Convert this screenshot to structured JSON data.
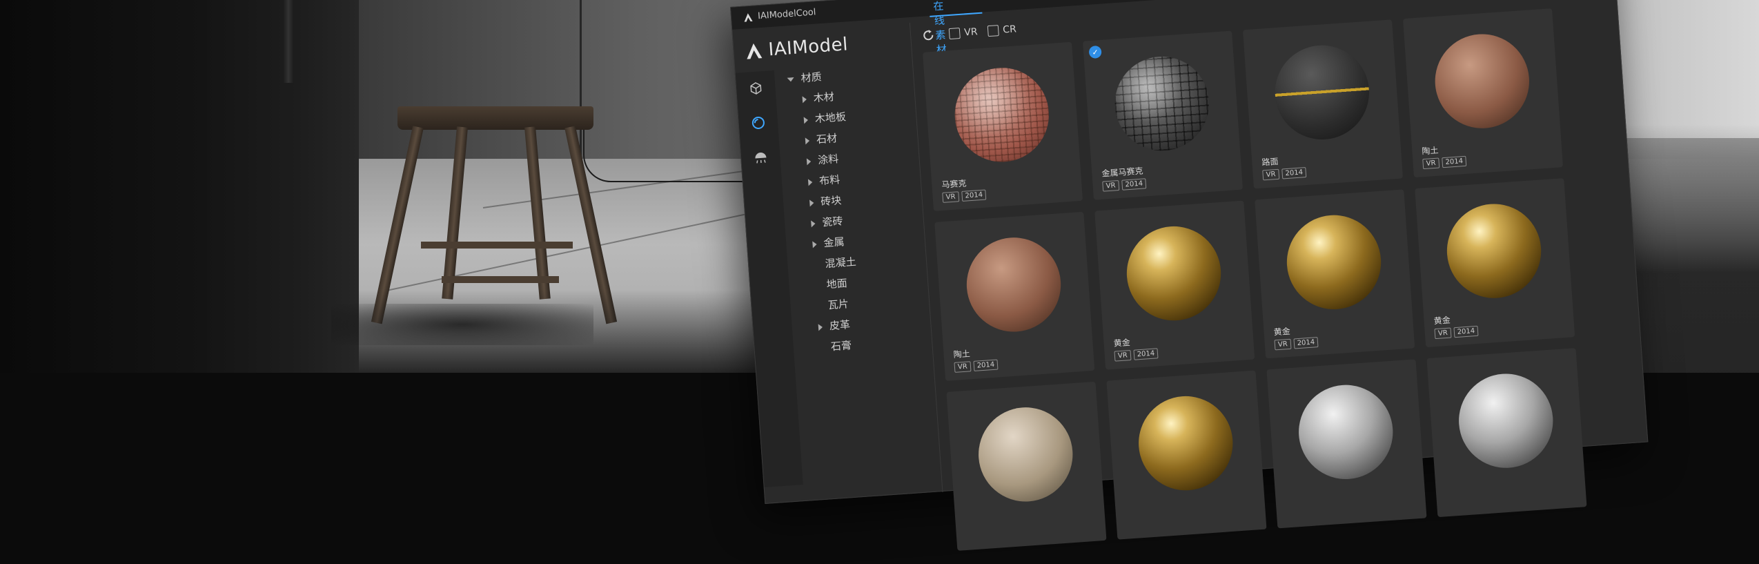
{
  "window": {
    "title": "IAIModelCool",
    "brand": "IAIModel"
  },
  "tabs": [
    {
      "label": "在线素材",
      "active": true
    }
  ],
  "filters": [
    {
      "label": "VR",
      "checked": false
    },
    {
      "label": "CR",
      "checked": false
    }
  ],
  "sidebar_icons": [
    "cube-icon",
    "material-sphere-icon",
    "lighting-icon"
  ],
  "tree": [
    {
      "label": "材质",
      "expanded": true
    },
    {
      "label": "木材"
    },
    {
      "label": "木地板"
    },
    {
      "label": "石材"
    },
    {
      "label": "涂料"
    },
    {
      "label": "布料"
    },
    {
      "label": "砖块"
    },
    {
      "label": "瓷砖"
    },
    {
      "label": "金属"
    },
    {
      "label": "混凝土"
    },
    {
      "label": "地面"
    },
    {
      "label": "瓦片"
    },
    {
      "label": "皮革"
    },
    {
      "label": "石膏"
    }
  ],
  "materials": [
    {
      "name": "马赛克",
      "tags": [
        "VR",
        "2014"
      ],
      "style": "mosaic"
    },
    {
      "name": "金属马赛克",
      "tags": [
        "VR",
        "2014"
      ],
      "style": "metalmosaic",
      "selected": true
    },
    {
      "name": "路面",
      "tags": [
        "VR",
        "2014"
      ],
      "style": "road"
    },
    {
      "name": "陶土",
      "tags": [
        "VR",
        "2014"
      ],
      "style": "clay"
    },
    {
      "name": "陶土",
      "tags": [
        "VR",
        "2014"
      ],
      "style": "clay"
    },
    {
      "name": "黄金",
      "tags": [
        "VR",
        "2014"
      ],
      "style": "gold"
    },
    {
      "name": "黄金",
      "tags": [
        "VR",
        "2014"
      ],
      "style": "gold"
    },
    {
      "name": "黄金",
      "tags": [
        "VR",
        "2014"
      ],
      "style": "gold"
    },
    {
      "name": "",
      "tags": [],
      "style": "stone"
    },
    {
      "name": "",
      "tags": [],
      "style": "gold"
    },
    {
      "name": "",
      "tags": [],
      "style": "silver"
    },
    {
      "name": "",
      "tags": [],
      "style": "silver"
    }
  ]
}
